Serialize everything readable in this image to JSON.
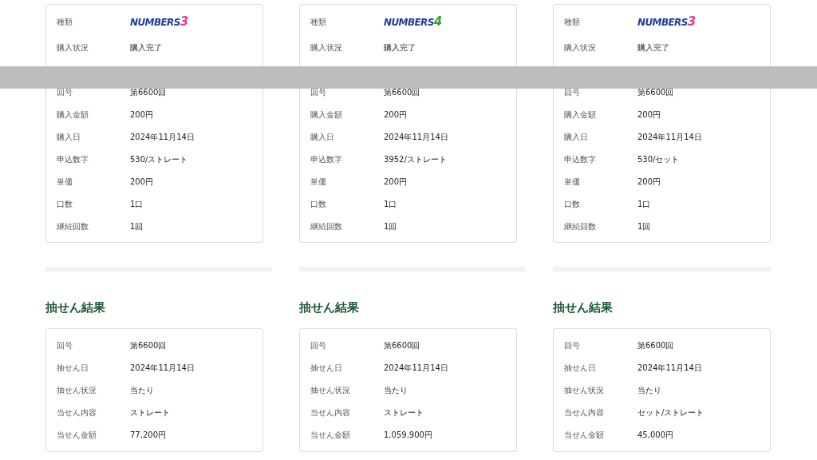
{
  "columns": [
    {
      "purchase": [
        {
          "kind": "logo",
          "label": "種類",
          "word": "NUMBERS",
          "digit": "3",
          "color": "#e23a8e"
        },
        {
          "kind": "text",
          "label": "購入状況",
          "value": "購入完了"
        },
        {
          "kind": "hidden"
        },
        {
          "kind": "text",
          "label": "回号",
          "value": "第6600回"
        },
        {
          "kind": "text",
          "label": "購入金額",
          "value": "200円"
        },
        {
          "kind": "text",
          "label": "購入日",
          "value": "2024年11月14日"
        },
        {
          "kind": "text",
          "label": "申込数字",
          "value": "530/ストレート"
        },
        {
          "kind": "text",
          "label": "単価",
          "value": "200円"
        },
        {
          "kind": "text",
          "label": "口数",
          "value": "1口"
        },
        {
          "kind": "text",
          "label": "継続回数",
          "value": "1回"
        }
      ],
      "result_title": "抽せん結果",
      "result": [
        {
          "label": "回号",
          "value": "第6600回"
        },
        {
          "label": "抽せん日",
          "value": "2024年11月14日"
        },
        {
          "label": "抽せん状況",
          "value": "当たり"
        },
        {
          "label": "当せん内容",
          "value": "ストレート"
        },
        {
          "label": "当せん金額",
          "value": "77,200円"
        }
      ]
    },
    {
      "purchase": [
        {
          "kind": "logo",
          "label": "種類",
          "word": "NUMBERS",
          "digit": "4",
          "color": "#3a9e3a"
        },
        {
          "kind": "text",
          "label": "購入状況",
          "value": "購入完了"
        },
        {
          "kind": "hidden"
        },
        {
          "kind": "text",
          "label": "回号",
          "value": "第6600回"
        },
        {
          "kind": "text",
          "label": "購入金額",
          "value": "200円"
        },
        {
          "kind": "text",
          "label": "購入日",
          "value": "2024年11月14日"
        },
        {
          "kind": "text",
          "label": "申込数字",
          "value": "3952/ストレート"
        },
        {
          "kind": "text",
          "label": "単価",
          "value": "200円"
        },
        {
          "kind": "text",
          "label": "口数",
          "value": "1口"
        },
        {
          "kind": "text",
          "label": "継続回数",
          "value": "1回"
        }
      ],
      "result_title": "抽せん結果",
      "result": [
        {
          "label": "回号",
          "value": "第6600回"
        },
        {
          "label": "抽せん日",
          "value": "2024年11月14日"
        },
        {
          "label": "抽せん状況",
          "value": "当たり"
        },
        {
          "label": "当せん内容",
          "value": "ストレート"
        },
        {
          "label": "当せん金額",
          "value": "1,059,900円"
        }
      ]
    },
    {
      "purchase": [
        {
          "kind": "logo",
          "label": "種類",
          "word": "NUMBERS",
          "digit": "3",
          "color": "#e23a8e"
        },
        {
          "kind": "text",
          "label": "購入状況",
          "value": "購入完了"
        },
        {
          "kind": "hidden"
        },
        {
          "kind": "text",
          "label": "回号",
          "value": "第6600回"
        },
        {
          "kind": "text",
          "label": "購入金額",
          "value": "200円"
        },
        {
          "kind": "text",
          "label": "購入日",
          "value": "2024年11月14日"
        },
        {
          "kind": "text",
          "label": "申込数字",
          "value": "530/セット"
        },
        {
          "kind": "text",
          "label": "単価",
          "value": "200円"
        },
        {
          "kind": "text",
          "label": "口数",
          "value": "1口"
        },
        {
          "kind": "text",
          "label": "継続回数",
          "value": "1回"
        }
      ],
      "result_title": "抽せん結果",
      "result": [
        {
          "label": "回号",
          "value": "第6600回"
        },
        {
          "label": "抽せん日",
          "value": "2024年11月14日"
        },
        {
          "label": "抽せん状況",
          "value": "当たり"
        },
        {
          "label": "当せん内容",
          "value": "セット/ストレート"
        },
        {
          "label": "当せん金額",
          "value": "45,000円"
        }
      ]
    }
  ]
}
